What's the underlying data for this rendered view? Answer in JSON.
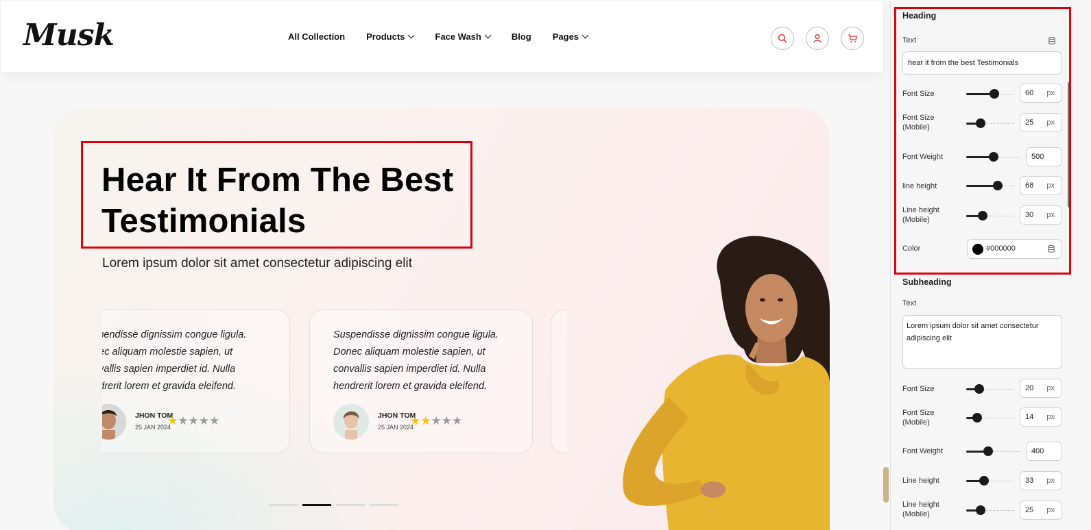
{
  "brand": {
    "logo": "Musk"
  },
  "nav": [
    {
      "label": "All Collection",
      "has_dropdown": false
    },
    {
      "label": "Products",
      "has_dropdown": true
    },
    {
      "label": "Face Wash",
      "has_dropdown": true
    },
    {
      "label": "Blog",
      "has_dropdown": false
    },
    {
      "label": "Pages",
      "has_dropdown": true
    }
  ],
  "header_icons": [
    "search-icon",
    "user-icon",
    "cart-icon"
  ],
  "hero": {
    "heading_line1": "Hear It From The Best",
    "heading_line2": "Testimonials",
    "subheading": "Lorem ipsum dolor sit amet consectetur adipiscing elit"
  },
  "testimonials": [
    {
      "lines": [
        "uspendisse dignissim congue ligula.",
        "onec aliquam molestie sapien, ut",
        "onvallis sapien imperdiet id. Nulla",
        "endrerit lorem et gravida eleifend."
      ],
      "name": "JHON TOM",
      "date": "25 JAN 2024",
      "rating": 1,
      "max_rating": 5
    },
    {
      "lines": [
        "Suspendisse dignissim congue ligula.",
        "Donec aliquam molestie sapien, ut",
        "convallis sapien imperdiet id. Nulla",
        "hendrerit lorem et gravida eleifend."
      ],
      "name": "JHON TOM",
      "date": "25 JAN 2024",
      "rating": 2,
      "max_rating": 5
    }
  ],
  "carousel": {
    "pages": 4,
    "active_page": 2
  },
  "settings": {
    "heading": {
      "title": "Heading",
      "text_label": "Text",
      "text_value": "hear it from the best Testimonials",
      "font_size": {
        "label": "Font Size",
        "value": "60",
        "unit": "px",
        "level": 0.55
      },
      "font_size_mobile": {
        "label_line1": "Font Size",
        "label_line2": "(Mobile)",
        "value": "25",
        "unit": "px",
        "level": 0.3
      },
      "font_weight": {
        "label": "Font Weight",
        "value": "500",
        "level": 0.5
      },
      "line_height": {
        "label": "line height",
        "value": "68",
        "unit": "px",
        "level": 0.65
      },
      "line_height_mobile": {
        "label_line1": "Line height",
        "label_line2": "(Mobile)",
        "value": "30",
        "unit": "px",
        "level": 0.33
      },
      "color": {
        "label": "Color",
        "value": "#000000"
      }
    },
    "subheading": {
      "title": "Subheading",
      "text_label": "Text",
      "text_value": "Lorem ipsum dolor sit amet consectetur adipiscing elit",
      "font_size": {
        "label": "Font Size",
        "value": "20",
        "unit": "px",
        "level": 0.25
      },
      "font_size_mobile": {
        "label_line1": "Font Size",
        "label_line2": "(Mobile)",
        "value": "14",
        "unit": "px",
        "level": 0.22
      },
      "font_weight": {
        "label": "Font Weight",
        "value": "400",
        "level": 0.4
      },
      "line_height": {
        "label": "Line height",
        "value": "33",
        "unit": "px",
        "level": 0.35
      },
      "line_height_mobile": {
        "label_line1": "Line height",
        "label_line2": "(Mobile)",
        "value": "25",
        "unit": "px",
        "level": 0.3
      }
    }
  },
  "colors": {
    "highlight": "#e0000a",
    "star_filled": "#f2c500",
    "star_empty": "#9a9a9a",
    "sweater": "#e8b531"
  }
}
